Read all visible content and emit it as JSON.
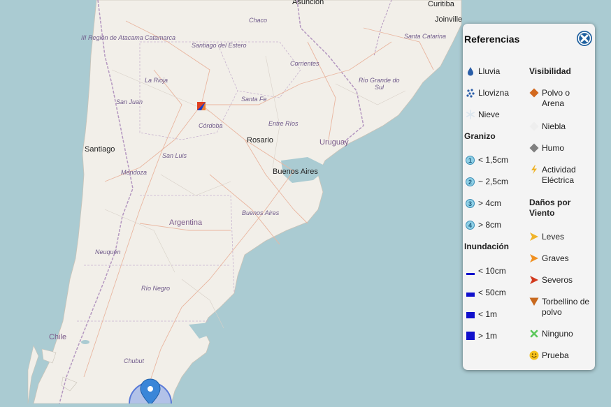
{
  "map": {
    "labels": {
      "asuncion": "Asunción",
      "curitiba": "Curitiba",
      "joinville": "Joinville",
      "chaco": "Chaco",
      "atacama": "III Región de Atacama",
      "catamarca": "Catamarca",
      "santiago_estero": "Santiago del Estero",
      "santa_catarina": "Santa Catarina",
      "corrientes": "Corrientes",
      "la_rioja": "La Rioja",
      "rio_grande_1": "Rio Grande do",
      "rio_grande_2": "Sul",
      "san_juan": "San Juan",
      "santa_fe": "Santa Fe",
      "cordoba": "Córdoba",
      "entre_rios": "Entre Ríos",
      "santiago": "Santiago",
      "rosario": "Rosario",
      "uruguay": "Uruguay",
      "san_luis": "San Luis",
      "mendoza": "Mendoza",
      "buenos_aires_city": "Buenos Aires",
      "buenos_aires_prov": "Buenos Aires",
      "argentina": "Argentina",
      "neuquen": "Neuquén",
      "rio_negro": "Río Negro",
      "chile": "Chile",
      "chubut": "Chubut"
    }
  },
  "legend": {
    "title": "Referencias",
    "left": {
      "lluvia": "Lluvia",
      "llovizna": "Llovizna",
      "nieve": "Nieve",
      "granizo_head": "Granizo",
      "g1": "< 1,5cm",
      "g2": "~ 2,5cm",
      "g3": "> 4cm",
      "g4": "> 8cm",
      "g1_n": "1",
      "g2_n": "2",
      "g3_n": "3",
      "g4_n": "4",
      "inundacion_head": "Inundación",
      "i1": "< 10cm",
      "i2": "< 50cm",
      "i3": "< 1m",
      "i4": "> 1m"
    },
    "right": {
      "visibilidad_head": "Visibilidad",
      "polvo": "Polvo o Arena",
      "niebla": "Niebla",
      "humo": "Humo",
      "actividad": "Actividad Eléctrica",
      "danos_head": "Daños por Viento",
      "leves": "Leves",
      "graves": "Graves",
      "severos": "Severos",
      "torbellino": "Torbellino de polvo",
      "ninguno": "Ninguno",
      "prueba": "Prueba"
    },
    "colors": {
      "rain": "#2a5ea8",
      "hail": "#8ed0e6",
      "flood": "#1010cc",
      "dust": "#d2691e",
      "smoke": "#808080",
      "wind_light": "#f0b429",
      "wind_medium": "#f09020",
      "wind_severe": "#d23a1e"
    }
  }
}
